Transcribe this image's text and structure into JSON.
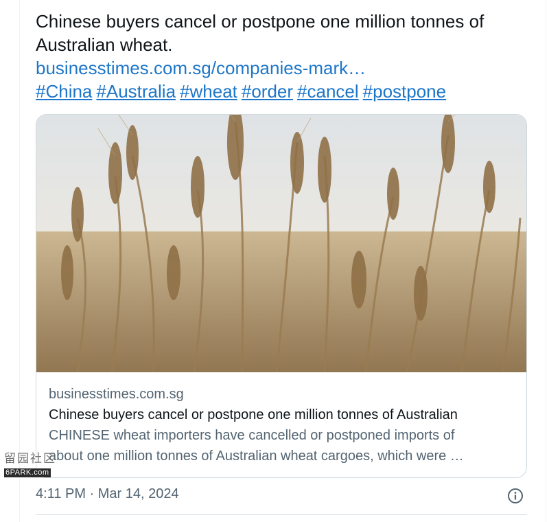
{
  "tweet": {
    "text_line1": "Chinese buyers cancel or postpone one million tonnes of",
    "text_line2": "Australian wheat.",
    "link_text": "businesstimes.com.sg/companies-mark…",
    "hashtags": [
      "#China",
      "#Australia",
      "#wheat",
      "#order",
      "#cancel",
      "#postpone"
    ]
  },
  "card": {
    "image_icon": "wheat-field-photo",
    "domain": "businesstimes.com.sg",
    "title": "Chinese buyers cancel or postpone one million tonnes of Australian",
    "description_line1": "CHINESE wheat importers have cancelled or postponed imports of",
    "description_line2": "about one million tonnes of Australian wheat cargoes, which were …"
  },
  "footer": {
    "timestamp": "4:11 PM · Mar 14, 2024",
    "info_icon": "info-icon"
  },
  "watermark": {
    "chars": "留园社区",
    "url": "6PARK.com"
  },
  "colors": {
    "link": "#1d76c9",
    "text_primary": "#0f1419",
    "text_secondary": "#536471",
    "border": "#cfd9de"
  }
}
